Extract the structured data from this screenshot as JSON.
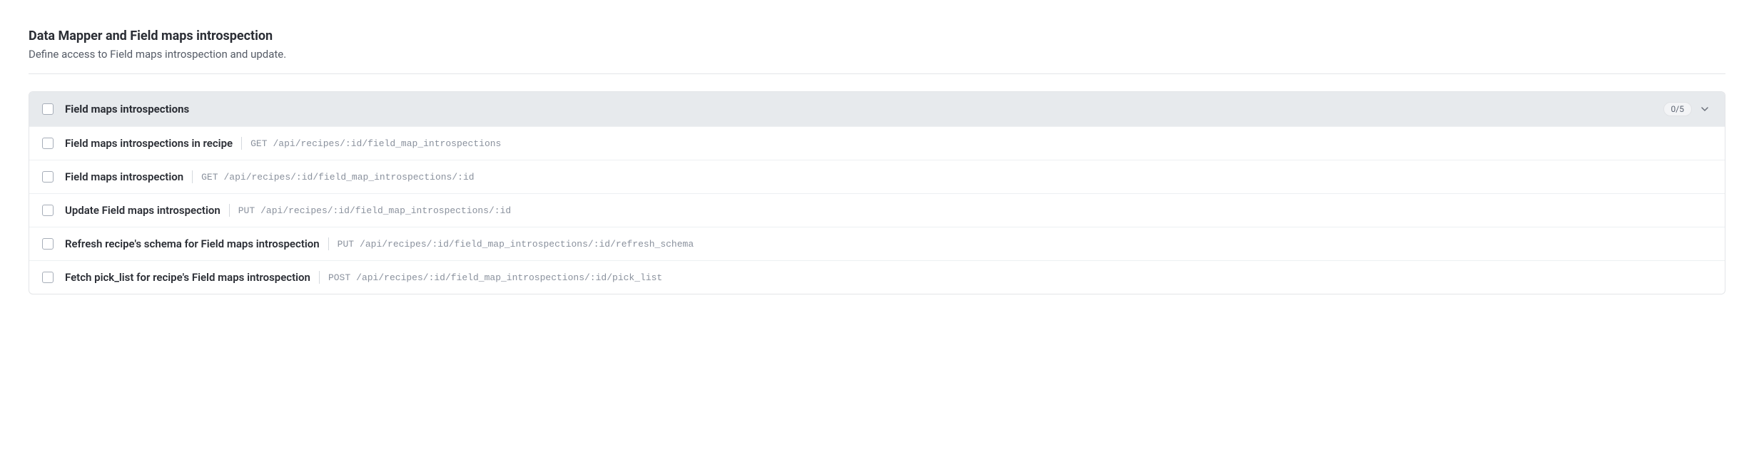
{
  "section": {
    "title": "Data Mapper and Field maps introspection",
    "subtitle": "Define access to Field maps introspection and update."
  },
  "group": {
    "label": "Field maps introspections",
    "count": "0/5"
  },
  "rows": [
    {
      "label": "Field maps introspections in recipe",
      "method": "GET",
      "path": "/api/recipes/:id/field_map_introspections"
    },
    {
      "label": "Field maps introspection",
      "method": "GET",
      "path": "/api/recipes/:id/field_map_introspections/:id"
    },
    {
      "label": "Update Field maps introspection",
      "method": "PUT",
      "path": "/api/recipes/:id/field_map_introspections/:id"
    },
    {
      "label": "Refresh recipe's schema for Field maps introspection",
      "method": "PUT",
      "path": "/api/recipes/:id/field_map_introspections/:id/refresh_schema"
    },
    {
      "label": "Fetch pick_list for recipe's Field maps introspection",
      "method": "POST",
      "path": "/api/recipes/:id/field_map_introspections/:id/pick_list"
    }
  ]
}
